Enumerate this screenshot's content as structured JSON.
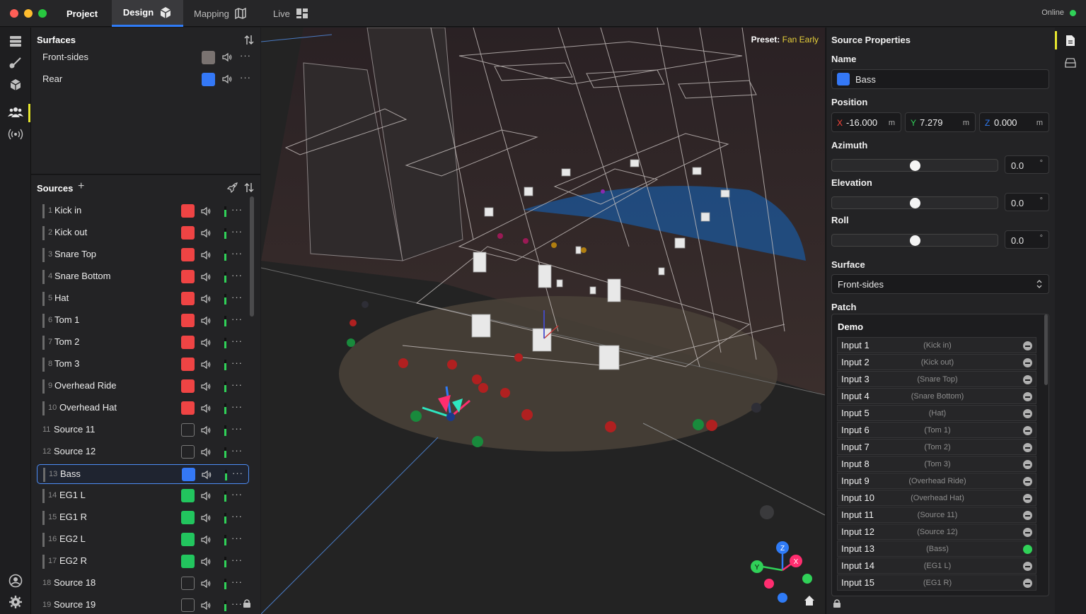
{
  "topbar": {
    "tabs": [
      {
        "label": "Project",
        "icon": "none"
      },
      {
        "label": "Design",
        "icon": "cube-icon"
      },
      {
        "label": "Mapping",
        "icon": "map-icon"
      },
      {
        "label": "Live",
        "icon": "layout-icon"
      }
    ],
    "status": "Online"
  },
  "surfaces": {
    "title": "Surfaces",
    "items": [
      {
        "name": "Front-sides",
        "color": "#7a7371"
      },
      {
        "name": "Rear",
        "color": "#3478f6"
      }
    ]
  },
  "sources": {
    "title": "Sources",
    "items": [
      {
        "num": "1",
        "name": "Kick in",
        "color": "#ef4444"
      },
      {
        "num": "2",
        "name": "Kick out",
        "color": "#ef4444"
      },
      {
        "num": "3",
        "name": "Snare Top",
        "color": "#ef4444"
      },
      {
        "num": "4",
        "name": "Snare Bottom",
        "color": "#ef4444"
      },
      {
        "num": "5",
        "name": "Hat",
        "color": "#ef4444"
      },
      {
        "num": "6",
        "name": "Tom 1",
        "color": "#ef4444"
      },
      {
        "num": "7",
        "name": "Tom 2",
        "color": "#ef4444"
      },
      {
        "num": "8",
        "name": "Tom 3",
        "color": "#ef4444"
      },
      {
        "num": "9",
        "name": "Overhead Ride",
        "color": "#ef4444"
      },
      {
        "num": "10",
        "name": "Overhead Hat",
        "color": "#ef4444"
      },
      {
        "num": "11",
        "name": "Source 11",
        "color": ""
      },
      {
        "num": "12",
        "name": "Source 12",
        "color": ""
      },
      {
        "num": "13",
        "name": "Bass",
        "color": "#3478f6"
      },
      {
        "num": "14",
        "name": "EG1 L",
        "color": "#22c55e"
      },
      {
        "num": "15",
        "name": "EG1 R",
        "color": "#22c55e"
      },
      {
        "num": "16",
        "name": "EG2 L",
        "color": "#22c55e"
      },
      {
        "num": "17",
        "name": "EG2 R",
        "color": "#22c55e"
      },
      {
        "num": "18",
        "name": "Source 18",
        "color": ""
      },
      {
        "num": "19",
        "name": "Source 19",
        "color": ""
      }
    ],
    "selected": "13"
  },
  "viewport": {
    "preset_label": "Preset:",
    "preset_value": "Fan Early",
    "gizmo": {
      "x": "X",
      "y": "Y",
      "z": "Z"
    }
  },
  "properties": {
    "title": "Source Properties",
    "name_label": "Name",
    "name_value": "Bass",
    "name_color": "#3478f6",
    "position_label": "Position",
    "x_label": "X",
    "x_value": "-16.000",
    "x_unit": "m",
    "y_label": "Y",
    "y_value": "7.279",
    "y_unit": "m",
    "z_label": "Z",
    "z_value": "0.000",
    "z_unit": "m",
    "azimuth_label": "Azimuth",
    "azimuth_value": "0.0",
    "azimuth_level": 0.5,
    "elevation_label": "Elevation",
    "elevation_value": "0.0",
    "elevation_level": 0.5,
    "roll_label": "Roll",
    "roll_value": "0.0",
    "roll_level": 0.5,
    "degree": "°",
    "surface_label": "Surface",
    "surface_value": "Front-sides",
    "patch_label": "Patch",
    "patch_group": "Demo",
    "patch": [
      {
        "input": "Input 1",
        "source": "(Kick in)",
        "state": "off"
      },
      {
        "input": "Input 2",
        "source": "(Kick out)",
        "state": "off"
      },
      {
        "input": "Input 3",
        "source": "(Snare Top)",
        "state": "off"
      },
      {
        "input": "Input 4",
        "source": "(Snare Bottom)",
        "state": "off"
      },
      {
        "input": "Input 5",
        "source": "(Hat)",
        "state": "off"
      },
      {
        "input": "Input 6",
        "source": "(Tom 1)",
        "state": "off"
      },
      {
        "input": "Input 7",
        "source": "(Tom 2)",
        "state": "off"
      },
      {
        "input": "Input 8",
        "source": "(Tom 3)",
        "state": "off"
      },
      {
        "input": "Input 9",
        "source": "(Overhead Ride)",
        "state": "off"
      },
      {
        "input": "Input 10",
        "source": "(Overhead Hat)",
        "state": "off"
      },
      {
        "input": "Input 11",
        "source": "(Source 11)",
        "state": "off"
      },
      {
        "input": "Input 12",
        "source": "(Source 12)",
        "state": "off"
      },
      {
        "input": "Input 13",
        "source": "(Bass)",
        "state": "on"
      },
      {
        "input": "Input 14",
        "source": "(EG1 L)",
        "state": "off"
      },
      {
        "input": "Input 15",
        "source": "(EG1 R)",
        "state": "off"
      }
    ]
  }
}
